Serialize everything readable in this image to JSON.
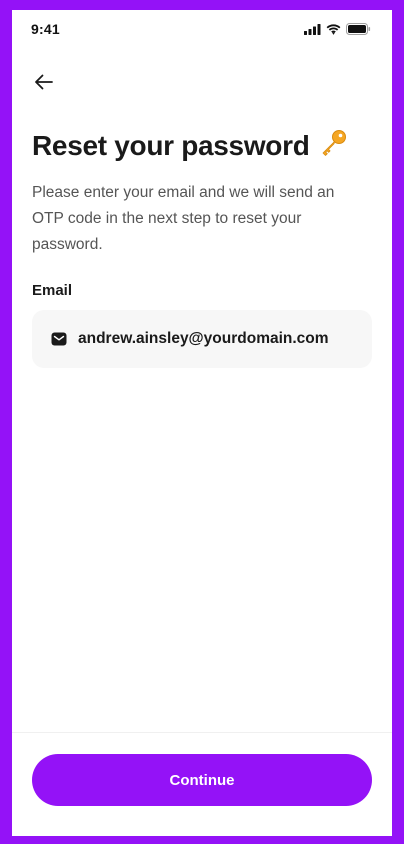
{
  "status_bar": {
    "time": "9:41",
    "icons": [
      "cellular-signal-icon",
      "wifi-icon",
      "battery-icon"
    ]
  },
  "header": {
    "back_icon": "arrow-left-icon"
  },
  "content": {
    "title": "Reset your password",
    "title_icon": "key-icon",
    "description": "Please enter your email and we will send an OTP code in the next step to reset your password.",
    "email_label": "Email",
    "email_icon": "mail-icon",
    "email_value": "andrew.ainsley@yourdomain.com"
  },
  "footer": {
    "continue_label": "Continue"
  },
  "colors": {
    "accent": "#9412F7",
    "text_primary": "#1A1A1A",
    "text_secondary": "#555555",
    "field_background": "#F7F7F7",
    "key_gold": "#F5A623"
  }
}
